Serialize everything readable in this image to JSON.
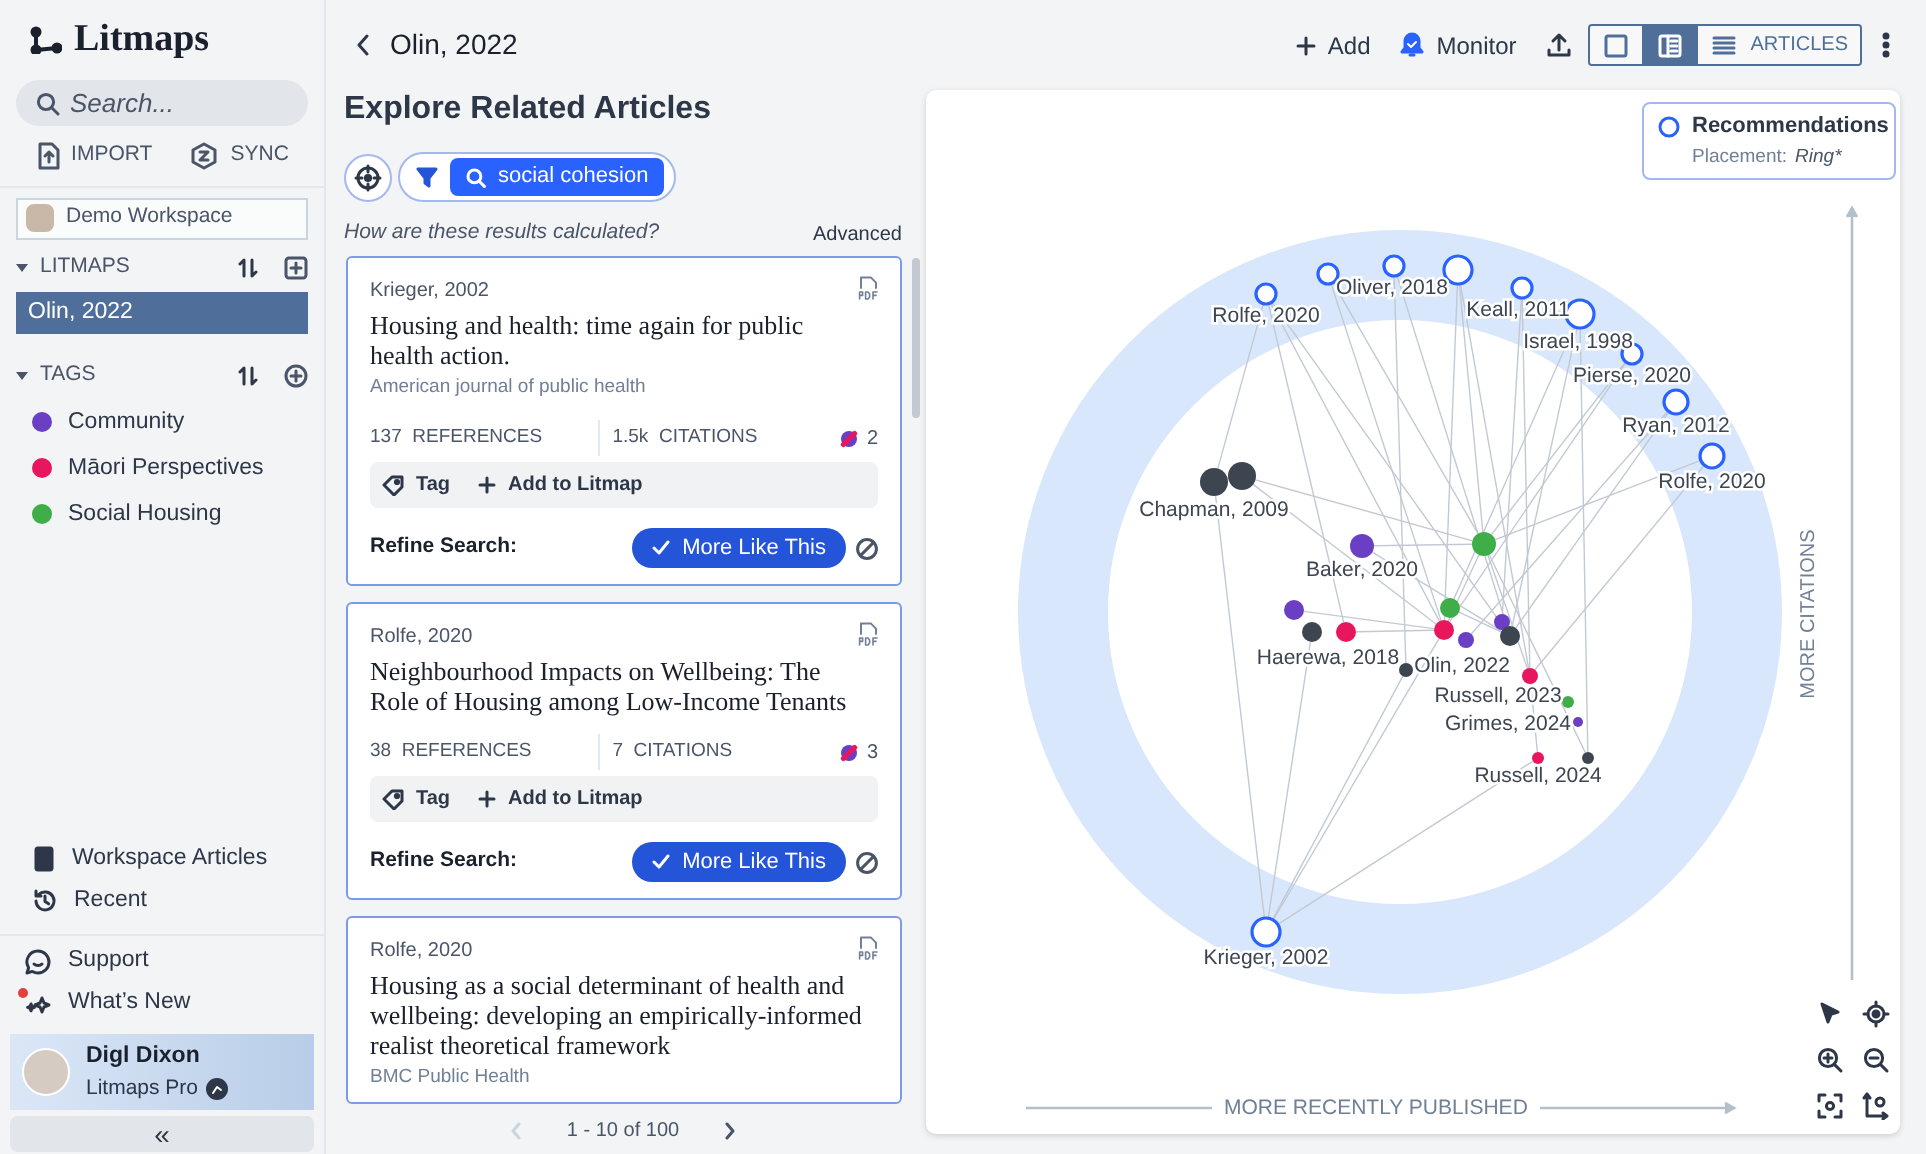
{
  "sidebar": {
    "logo": "Litmaps",
    "search": {
      "placeholder": "Search..."
    },
    "actions": [
      {
        "label": "IMPORT",
        "kind": "import"
      },
      {
        "label": "SYNC",
        "kind": "sync"
      }
    ],
    "workspace": "Demo Workspace",
    "litmaps": {
      "title": "LITMAPS",
      "expanded": true,
      "items": [
        {
          "label": "Olin, 2022",
          "selected": true
        }
      ]
    },
    "tags": {
      "title": "TAGS",
      "expanded": true,
      "items": [
        {
          "label": "Community",
          "color": "#6b3fc4"
        },
        {
          "label": "Māori Perspectives",
          "color": "#e8175d"
        },
        {
          "label": "Social Housing",
          "color": "#3fae49"
        }
      ]
    },
    "links": [
      {
        "label": "Workspace Articles",
        "kind": "articles"
      },
      {
        "label": "Recent",
        "kind": "recent"
      }
    ],
    "help": [
      {
        "label": "Support",
        "kind": "support",
        "badge": false
      },
      {
        "label": "What’s New",
        "kind": "news",
        "badge": true
      }
    ],
    "user": {
      "name": "Digl Dixon",
      "plan": "Litmaps Pro"
    },
    "collapse": "«"
  },
  "header": {
    "title": "Olin, 2022",
    "actions": [
      {
        "label": "Add",
        "kind": "add"
      },
      {
        "label": "Monitor",
        "kind": "monitor"
      }
    ],
    "views": [
      {
        "kind": "map",
        "selected": false
      },
      {
        "kind": "split",
        "selected": true
      },
      {
        "kind": "list",
        "label": "ARTICLES",
        "selected": false
      }
    ]
  },
  "explore": {
    "title": "Explore Related Articles",
    "search_chip": "social cohesion",
    "help_link": "How are these results calculated?",
    "advanced": "Advanced",
    "articles": [
      {
        "author_year": "Krieger, 2002",
        "title": "Housing and health: time again for public health action.",
        "journal": "American journal of public health",
        "references": "137",
        "references_label": "REFERENCES",
        "citations": "1.5k",
        "citations_label": "CITATIONS",
        "tag_count": "2",
        "tag_label": "Tag",
        "add_label": "Add to Litmap",
        "refine_label": "Refine Search:",
        "more_like_this": {
          "label": "More Like This",
          "selected": true
        }
      },
      {
        "author_year": "Rolfe, 2020",
        "title": "Neighbourhood Impacts on Wellbeing: The Role of Housing among Low-Income Tenants",
        "references": "38",
        "references_label": "REFERENCES",
        "citations": "7",
        "citations_label": "CITATIONS",
        "tag_count": "3",
        "tag_label": "Tag",
        "add_label": "Add to Litmap",
        "refine_label": "Refine Search:",
        "more_like_this": {
          "label": "More Like This",
          "selected": true
        }
      },
      {
        "author_year": "Rolfe, 2020",
        "title": "Housing as a social determinant of health and wellbeing: developing an empirically-informed realist theoretical framework",
        "journal": "BMC Public Health"
      }
    ],
    "pagination": {
      "range": "1 - 10 of 100",
      "prev_disabled": true
    }
  },
  "graph": {
    "legend": {
      "title": "Recommendations",
      "placement_label": "Placement:",
      "placement_value": "Ring*"
    },
    "y_axis": "MORE CITATIONS",
    "x_axis": "MORE RECENTLY PUBLISHED",
    "nodes": [
      {
        "kind": "recommendation",
        "label": "Rolfe, 2020",
        "color": "#2962ff"
      },
      {
        "kind": "recommendation",
        "color": "#2962ff"
      },
      {
        "kind": "recommendation",
        "label": "Oliver, 2018",
        "color": "#2962ff"
      },
      {
        "kind": "recommendation",
        "color": "#2962ff"
      },
      {
        "kind": "recommendation",
        "label": "Keall, 2011",
        "color": "#2962ff"
      },
      {
        "kind": "recommendation",
        "label": "Israel, 1998",
        "color": "#2962ff"
      },
      {
        "kind": "recommendation",
        "label": "Pierse, 2020",
        "color": "#2962ff"
      },
      {
        "kind": "recommendation",
        "label": "Ryan, 2012",
        "color": "#2962ff"
      },
      {
        "kind": "recommendation",
        "label": "Rolfe, 2020",
        "color": "#2962ff"
      },
      {
        "kind": "article",
        "label": "Chapman, 2009",
        "color": "#3d4550"
      },
      {
        "kind": "article",
        "color": "#3d4550"
      },
      {
        "kind": "article",
        "label": "Baker, 2020",
        "color": "#6b3fc4"
      },
      {
        "kind": "article",
        "color": "#3fae49"
      },
      {
        "kind": "article",
        "color": "#6b3fc4"
      },
      {
        "kind": "article",
        "color": "#3d4550"
      },
      {
        "kind": "article",
        "label": "Haerewa, 2018",
        "color": "#e8175d"
      },
      {
        "kind": "article",
        "color": "#3d4550"
      },
      {
        "kind": "article",
        "color": "#3fae49"
      },
      {
        "kind": "article",
        "label": "Olin, 2022",
        "color": "#e8175d"
      },
      {
        "kind": "article",
        "color": "#6b3fc4"
      },
      {
        "kind": "article",
        "color": "#6b3fc4"
      },
      {
        "kind": "article",
        "color": "#3d4550"
      },
      {
        "kind": "article",
        "label": "Russell, 2023",
        "color": "#e8175d"
      },
      {
        "kind": "article",
        "label": "Grimes, 2024",
        "color": "#3fae49"
      },
      {
        "kind": "article",
        "color": "#6b3fc4"
      },
      {
        "kind": "article",
        "label": "Russell, 2024",
        "color": "#e8175d"
      },
      {
        "kind": "article",
        "color": "#3d4550"
      },
      {
        "kind": "recommendation",
        "label": "Krieger, 2002",
        "color": "#2962ff"
      }
    ]
  }
}
